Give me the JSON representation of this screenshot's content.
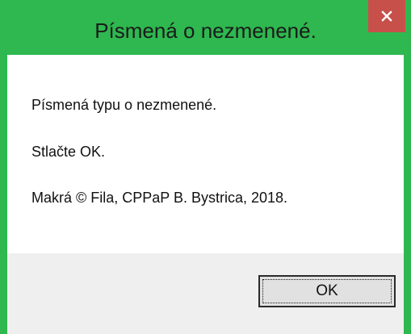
{
  "window": {
    "title": "Písmená o nezmenené.",
    "titlebar_color": "#2eb84f",
    "close_color": "#c7504a"
  },
  "message": {
    "lines": [
      "Písmená typu o nezmenené.",
      "Stlačte OK.",
      "Makrá © Fila, CPPaP B. Bystrica, 2018."
    ]
  },
  "buttons": {
    "ok_label": "OK"
  },
  "icons": {
    "close": "close-icon"
  }
}
